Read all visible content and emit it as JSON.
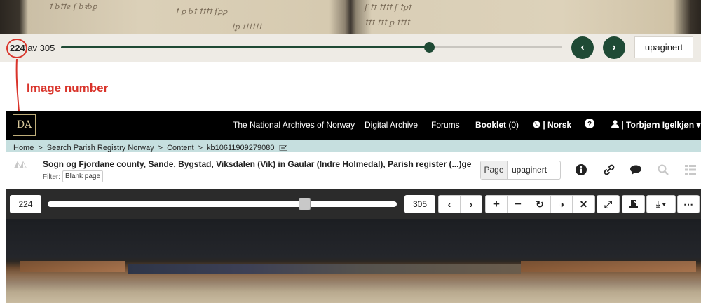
{
  "top_viewer": {
    "page_current": "224",
    "page_separator": " av ",
    "page_total": "305",
    "progress": 0.734,
    "prev_label": "‹",
    "next_label": "›",
    "pagination_label": "upaginert",
    "accent_color": "#1f4a35"
  },
  "annotation": {
    "label": "Image number",
    "color": "#d9342b"
  },
  "nav": {
    "logo": "DA",
    "items": [
      "The National Archives of Norway",
      "Digital Archive",
      "Forums"
    ],
    "booklet_label": "Booklet",
    "booklet_count": "(0)",
    "language": "| Norsk",
    "user": "| Torbjørn Igelkjøn"
  },
  "breadcrumb": {
    "items": [
      "Home",
      ">",
      "Search Parish Registry Norway",
      ">",
      "Content",
      ">",
      "kb10611909279080"
    ]
  },
  "document": {
    "title": "Sogn og Fjordane county, Sande, Bygstad, Viksdalen (Vik) in Gaular (Indre Holmedal), Parish register (...)ge",
    "filter_label": "Filter:",
    "filter_value": "Blank page",
    "page_label": "Page",
    "page_value": "upaginert"
  },
  "viewer": {
    "image_number": "224",
    "image_total": "305",
    "progress": 0.734,
    "buttons": [
      "‹",
      "›",
      "+",
      "−",
      "↻",
      "◑",
      "✕",
      "⤢",
      "",
      "⤓ ▾",
      "⋯"
    ]
  }
}
